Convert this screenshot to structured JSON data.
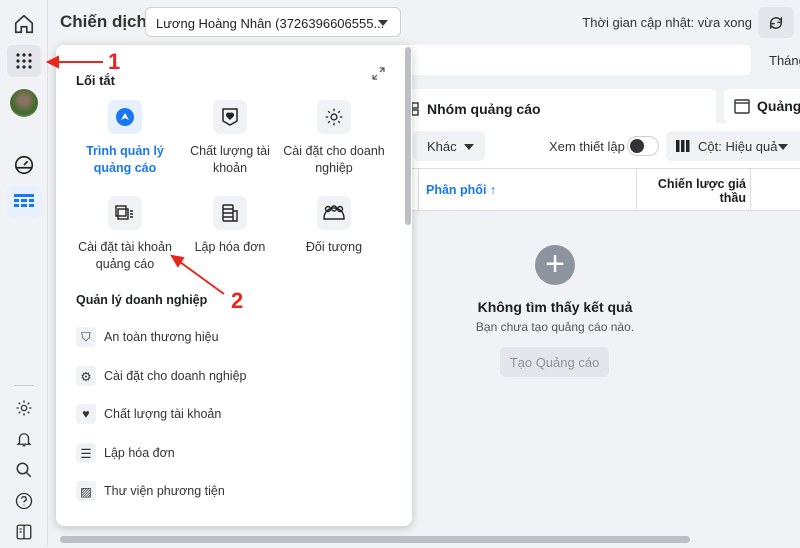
{
  "sidebar": {
    "icons": [
      "home-icon",
      "apps-grid-icon",
      "avatar",
      "dashboard-gauge-icon",
      "table-icon",
      "settings-icon",
      "bell-icon",
      "search-icon",
      "help-icon",
      "panel-toggle-icon"
    ]
  },
  "header": {
    "title": "Chiến dịch",
    "account": "Lương Hoàng Nhân (3726396606555...",
    "updated": "Thời gian cập nhật: vừa xong",
    "date_button": "Tháng"
  },
  "tabs": [
    {
      "label": "Nhóm quảng cáo"
    },
    {
      "label": "Quảng"
    }
  ],
  "toolbar": {
    "more": "Khác",
    "view_setup": "Xem thiết lập",
    "view_setup_on": false,
    "columns": "Cột: Hiệu quả"
  },
  "table": {
    "columns": [
      "Phân phối ↑",
      "Chiến lược giá thầu"
    ]
  },
  "empty": {
    "title": "Không tìm thấy kết quả",
    "subtitle": "Bạn chưa tạo quảng cáo nào.",
    "button": "Tạo Quảng cáo"
  },
  "popup": {
    "shortcuts_title": "Lối tắt",
    "shortcuts": [
      {
        "label": "Trình quản lý quảng cáo",
        "icon": "ads-manager-icon",
        "active": true
      },
      {
        "label": "Chất lượng tài khoản",
        "icon": "account-quality-icon"
      },
      {
        "label": "Cài đặt cho doanh nghiệp",
        "icon": "settings-icon"
      },
      {
        "label": "Cài đặt tài khoản quảng cáo",
        "icon": "ad-account-settings-icon"
      },
      {
        "label": "Lập hóa đơn",
        "icon": "billing-icon"
      },
      {
        "label": "Đối tượng",
        "icon": "audience-icon"
      }
    ],
    "business_title": "Quản lý doanh nghiệp",
    "business": [
      {
        "label": "An toàn thương hiệu",
        "icon": "shield-icon"
      },
      {
        "label": "Cài đặt cho doanh nghiệp",
        "icon": "settings-icon"
      },
      {
        "label": "Chất lượng tài khoản",
        "icon": "account-quality-icon"
      },
      {
        "label": "Lập hóa đơn",
        "icon": "billing-icon"
      },
      {
        "label": "Thư viện phương tiện",
        "icon": "media-library-icon"
      }
    ]
  },
  "annotations": [
    "1",
    "2"
  ],
  "colors": {
    "accent": "#1877f2",
    "annotation": "#e8261c"
  }
}
